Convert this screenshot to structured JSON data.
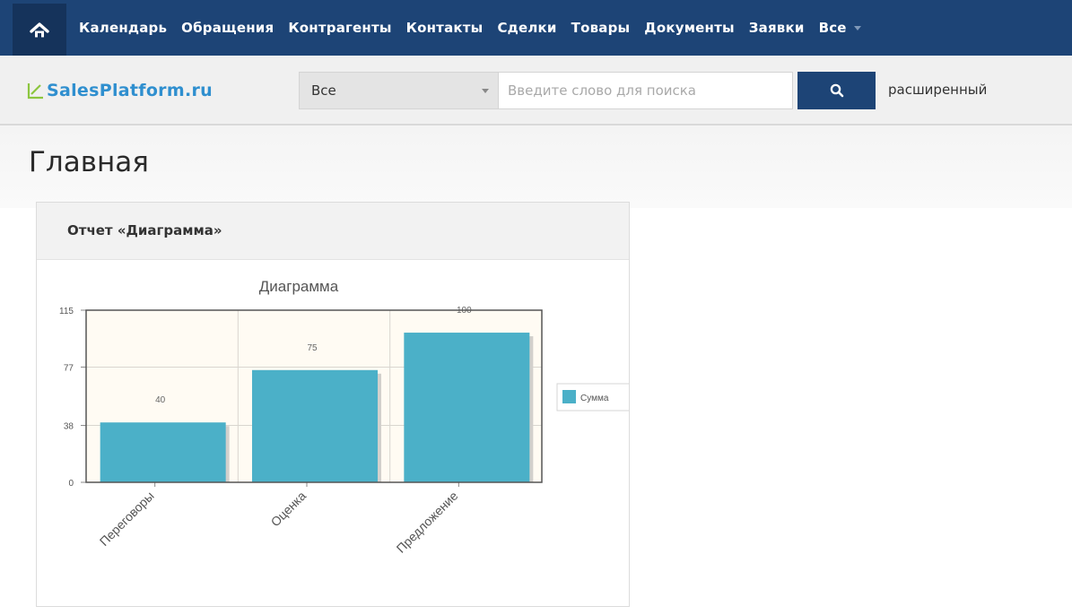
{
  "nav": {
    "home_icon": "home-icon",
    "items": [
      "Календарь",
      "Обращения",
      "Контрагенты",
      "Контакты",
      "Сделки",
      "Товары",
      "Документы",
      "Заявки",
      "Все"
    ]
  },
  "brand": {
    "logo_text": "SalesPlatform.ru"
  },
  "search": {
    "scope_value": "Все",
    "placeholder": "Введите слово для поиска",
    "button_icon": "search-icon",
    "advanced_label": "расширенный"
  },
  "page": {
    "title": "Главная"
  },
  "widget": {
    "title": "Отчет «Диаграмма»"
  },
  "colors": {
    "nav_bg": "#1d4476",
    "bar": "#4bb0c8",
    "logo": "#2f8fcf"
  },
  "chart_data": {
    "type": "bar",
    "title": "Диаграмма",
    "categories": [
      "Переговоры",
      "Оценка",
      "Предложение"
    ],
    "series": [
      {
        "name": "Сумма",
        "values": [
          40,
          75,
          100
        ]
      }
    ],
    "data_labels": [
      "40",
      "75",
      "100"
    ],
    "yticks": [
      "0",
      "38",
      "77",
      "115"
    ],
    "ylim": [
      0,
      115
    ],
    "grid": true,
    "legend": "right"
  }
}
